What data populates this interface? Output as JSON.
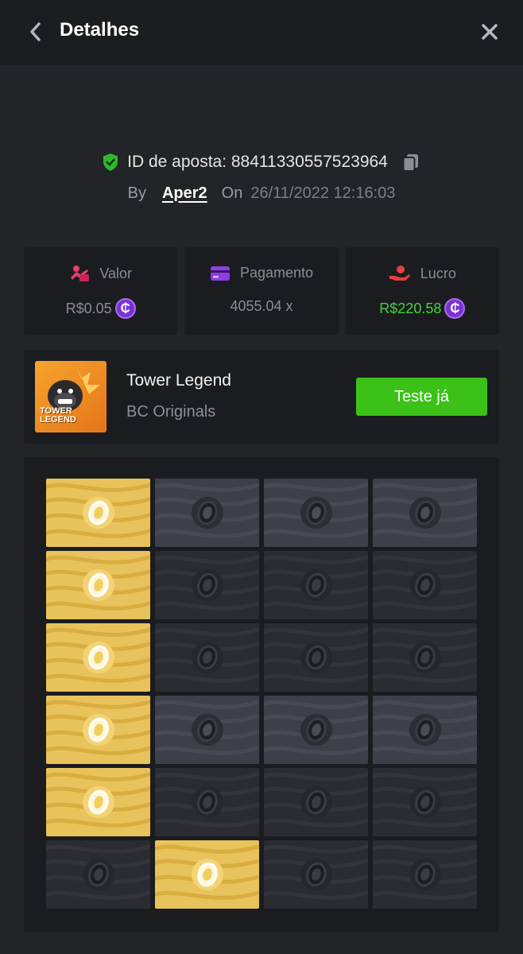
{
  "header": {
    "title": "Detalhes"
  },
  "bet": {
    "id_label": "ID de aposta: 88411330557523964",
    "by_label": "By",
    "username": "Aper2",
    "on_label": "On",
    "date": "26/11/2022 12:16:03"
  },
  "stats": [
    {
      "label": "Valor",
      "value": "R$0.05",
      "coin": "₵",
      "icon": "bet-amount-icon",
      "icon_color": "#e43f6f"
    },
    {
      "label": "Pagamento",
      "value": "4055.04 x",
      "icon": "card-icon",
      "icon_color": "#8b3fe4"
    },
    {
      "label": "Lucro",
      "value": "R$220.58",
      "coin": "₵",
      "icon": "profit-hand-icon",
      "icon_color": "#e4403f",
      "value_color": "#3fd43a"
    }
  ],
  "game": {
    "name": "Tower Legend",
    "provider": "BC Originals",
    "thumb_text": "TOWER LEGEND",
    "cta": "Teste já"
  },
  "board": {
    "rows": [
      [
        "gold",
        "revealed",
        "revealed",
        "revealed"
      ],
      [
        "gold",
        "dim",
        "dim",
        "dim"
      ],
      [
        "gold",
        "dim",
        "dim",
        "dim"
      ],
      [
        "gold",
        "revealed",
        "revealed",
        "revealed"
      ],
      [
        "gold",
        "dim",
        "dim",
        "dim"
      ],
      [
        "dim",
        "gold",
        "dim",
        "dim"
      ]
    ]
  },
  "colors": {
    "accent_green": "#3bc117",
    "gold": "#e8c35c",
    "coin_purple": "#7b2fd6"
  }
}
